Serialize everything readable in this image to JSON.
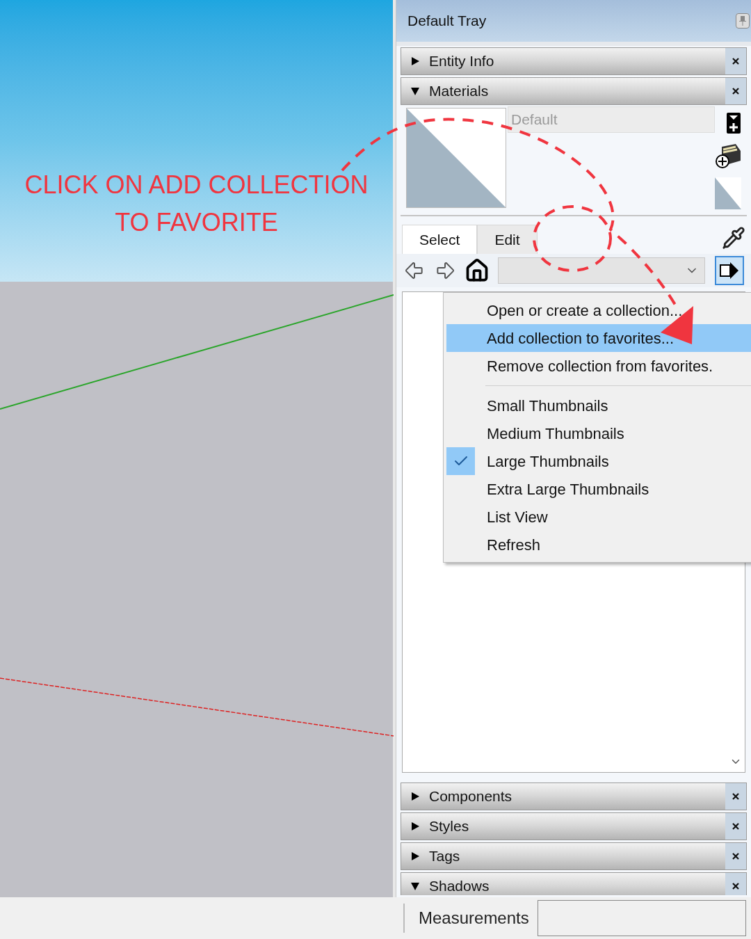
{
  "annotation": {
    "lines": [
      "CLICK ON ADD COLLECTION",
      "TO FAVORITE"
    ]
  },
  "tray": {
    "title": "Default Tray",
    "panels_top": [
      {
        "title": "Entity Info",
        "expanded": false
      },
      {
        "title": "Materials",
        "expanded": true
      }
    ],
    "materials": {
      "name": "Default",
      "tabs": [
        {
          "label": "Select",
          "selected": true
        },
        {
          "label": "Edit",
          "selected": false
        }
      ]
    },
    "menu": [
      {
        "kind": "item",
        "label": "Open or create a collection...",
        "selected": false,
        "checked": false
      },
      {
        "kind": "item",
        "label": "Add collection to favorites...",
        "selected": true,
        "checked": false
      },
      {
        "kind": "item",
        "label": "Remove collection from favorites.",
        "selected": false,
        "checked": false
      },
      {
        "kind": "separator"
      },
      {
        "kind": "item",
        "label": "Small Thumbnails",
        "selected": false,
        "checked": false
      },
      {
        "kind": "item",
        "label": "Medium Thumbnails",
        "selected": false,
        "checked": false
      },
      {
        "kind": "item",
        "label": "Large Thumbnails",
        "selected": false,
        "checked": true
      },
      {
        "kind": "item",
        "label": "Extra Large Thumbnails",
        "selected": false,
        "checked": false
      },
      {
        "kind": "item",
        "label": "List View",
        "selected": false,
        "checked": false
      },
      {
        "kind": "item",
        "label": "Refresh",
        "selected": false,
        "checked": false
      }
    ],
    "panels_bottom": [
      {
        "title": "Components",
        "expanded": false
      },
      {
        "title": "Styles",
        "expanded": false
      },
      {
        "title": "Tags",
        "expanded": false
      },
      {
        "title": "Shadows",
        "expanded": true
      }
    ]
  },
  "status_bar": {
    "label": "Measurements"
  }
}
